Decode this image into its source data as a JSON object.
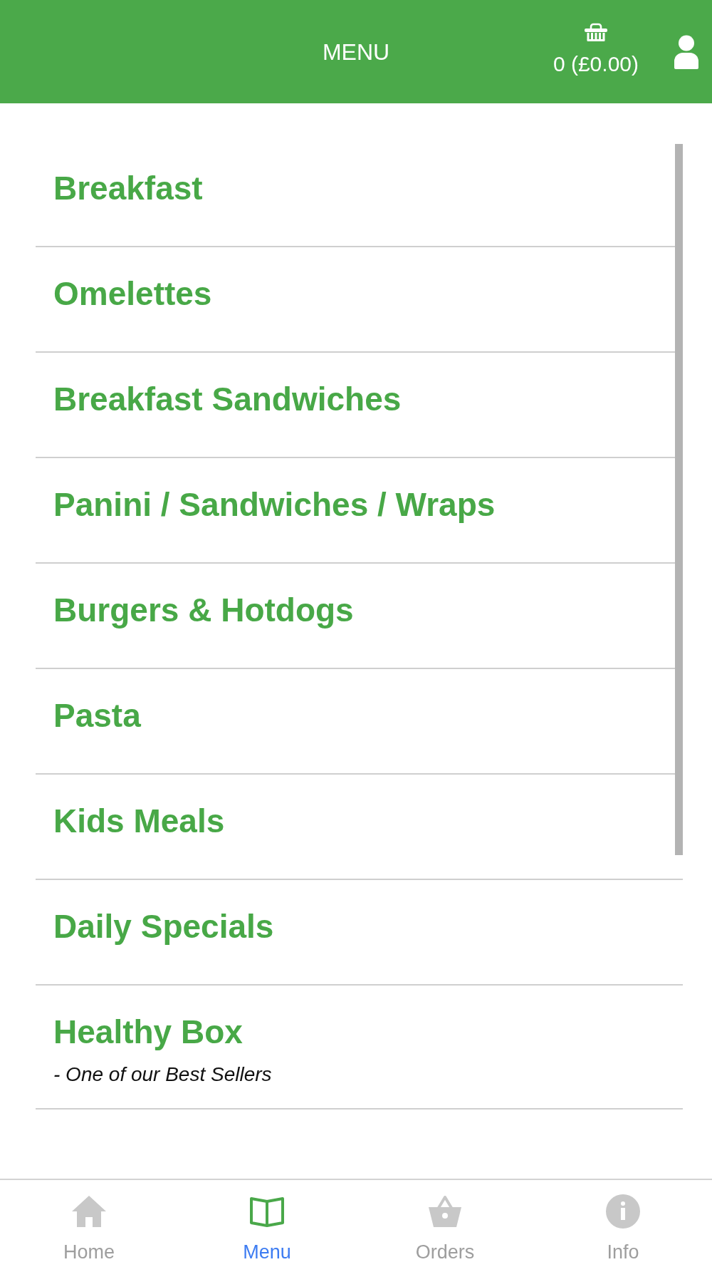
{
  "header": {
    "title": "MENU",
    "cart_summary": "0 (£0.00)"
  },
  "categories": [
    {
      "title": "Breakfast"
    },
    {
      "title": "Omelettes"
    },
    {
      "title": "Breakfast Sandwiches"
    },
    {
      "title": "Panini / Sandwiches / Wraps"
    },
    {
      "title": "Burgers & Hotdogs"
    },
    {
      "title": "Pasta"
    },
    {
      "title": "Kids Meals"
    },
    {
      "title": "Daily Specials"
    },
    {
      "title": "Healthy Box",
      "subtitle": "- One of our Best Sellers"
    }
  ],
  "bottom_nav": [
    {
      "label": "Home",
      "selected": false
    },
    {
      "label": "Menu",
      "selected": true
    },
    {
      "label": "Orders",
      "selected": false
    },
    {
      "label": "Info",
      "selected": false
    }
  ]
}
